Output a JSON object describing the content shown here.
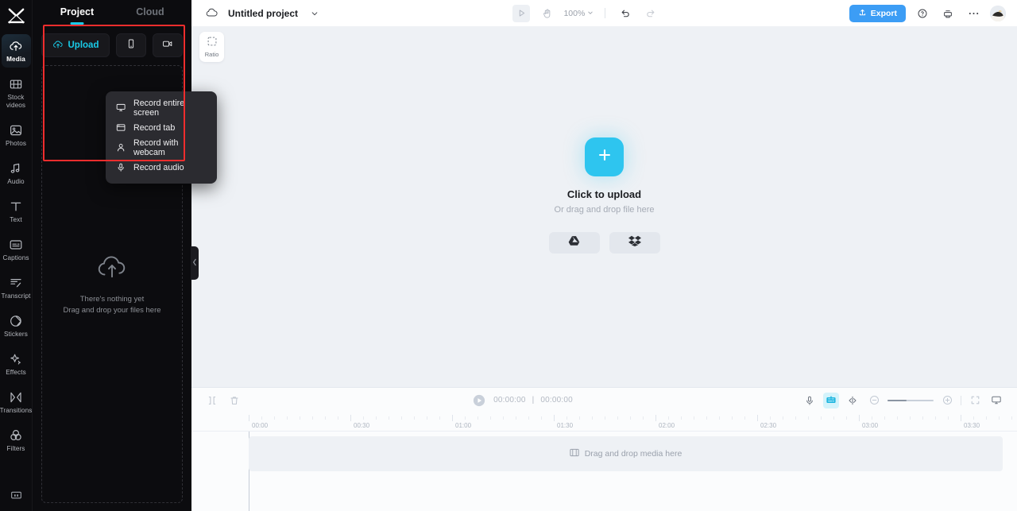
{
  "app": {
    "name": "video-editor",
    "accent": "#19cbe8",
    "export_color": "#3c9df5",
    "highlight_box_color": "#ef2d2d"
  },
  "rail": {
    "logo_icon": "app-logo-icon",
    "items": [
      {
        "label": "Media",
        "icon": "cloud-upload-icon",
        "active": true
      },
      {
        "label": "Stock\nvideos",
        "icon": "film-strip-icon",
        "active": false
      },
      {
        "label": "Photos",
        "icon": "image-icon",
        "active": false
      },
      {
        "label": "Audio",
        "icon": "music-note-icon",
        "active": false
      },
      {
        "label": "Text",
        "icon": "text-t-icon",
        "active": false
      },
      {
        "label": "Captions",
        "icon": "captions-icon",
        "active": false
      },
      {
        "label": "Transcript",
        "icon": "transcript-icon",
        "active": false
      },
      {
        "label": "Stickers",
        "icon": "sticker-icon",
        "active": false
      },
      {
        "label": "Effects",
        "icon": "effects-sparkle-icon",
        "active": false
      },
      {
        "label": "Transitions",
        "icon": "transitions-icon",
        "active": false
      },
      {
        "label": "Filters",
        "icon": "filters-rings-icon",
        "active": false
      }
    ],
    "bottom_icon": "presentation-icon"
  },
  "panel": {
    "tabs": [
      {
        "label": "Project",
        "active": true
      },
      {
        "label": "Cloud",
        "active": false
      }
    ],
    "upload_button": {
      "label": "Upload",
      "icon": "cloud-upload-icon"
    },
    "mobile_button_icon": "mobile-phone-icon",
    "record_button_icon": "video-camera-icon",
    "empty_state": {
      "icon": "cloud-upload-large-icon",
      "line1": "There's nothing yet",
      "line2": "Drag and drop your files here"
    },
    "collapse_icon": "chevron-left-icon",
    "record_menu": [
      {
        "label": "Record entire screen",
        "icon": "monitor-icon"
      },
      {
        "label": "Record tab",
        "icon": "browser-tab-icon"
      },
      {
        "label": "Record with webcam",
        "icon": "person-icon"
      },
      {
        "label": "Record audio",
        "icon": "microphone-icon"
      }
    ]
  },
  "topbar": {
    "cloud_icon": "cloud-icon",
    "project_title": "Untitled project",
    "title_chevron_icon": "chevron-down-icon",
    "play_icon": "play-triangle-icon",
    "hand_icon": "hand-cursor-icon",
    "zoom_level": "100%",
    "zoom_chevron_icon": "chevron-down-icon",
    "undo_icon": "undo-arrow-icon",
    "redo_icon": "redo-arrow-icon",
    "export_label": "Export",
    "export_icon": "export-upload-icon",
    "help_icon": "question-circle-icon",
    "print_icon": "printer-icon",
    "more_icon": "ellipsis-icon",
    "avatar_icon": "user-avatar"
  },
  "canvas": {
    "ratio_button": {
      "label": "Ratio",
      "icon": "ratio-dashed-square-icon"
    },
    "plus_icon": "plus-icon",
    "title": "Click to upload",
    "subtitle": "Or drag and drop file here",
    "cloud_buttons": [
      {
        "name": "google-drive",
        "icon": "google-drive-icon"
      },
      {
        "name": "dropbox",
        "icon": "dropbox-icon"
      }
    ]
  },
  "timeline": {
    "split_icon": "split-clip-icon",
    "delete_icon": "trash-icon",
    "play_icon": "play-circle-icon",
    "current_time": "00:00:00",
    "time_separator": "|",
    "total_time": "00:00:00",
    "mic_icon": "microphone-icon",
    "auto_captions_icon": "auto-captions-icon",
    "split_view_icon": "split-view-icon",
    "zoom_out_icon": "zoom-minus-icon",
    "zoom_in_icon": "zoom-plus-icon",
    "fit_icon": "fit-screen-icon",
    "monitor_icon": "monitor-preview-icon",
    "ruler_labels": [
      "00:00",
      "00:30",
      "01:00",
      "01:30",
      "02:00",
      "02:30",
      "03:00",
      "03:30"
    ],
    "ruler_positions": [
      72,
      200,
      328,
      456,
      584,
      712,
      840,
      968
    ],
    "drop_hint": "Drag and drop media here",
    "drop_hint_icon": "film-strip-icon"
  }
}
